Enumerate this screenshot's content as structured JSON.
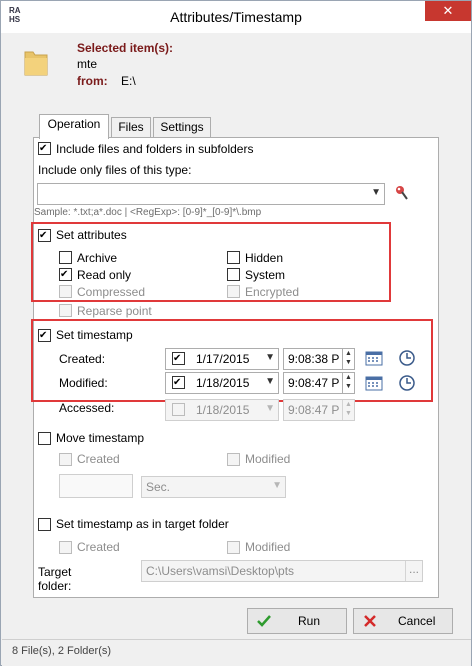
{
  "window": {
    "title": "Attributes/Timestamp",
    "app_icon_text": "RAHS"
  },
  "header": {
    "selected_label": "Selected item(s):",
    "selected_value": "mte",
    "from_label": "from:",
    "from_value": "E:\\"
  },
  "tabs": [
    "Operation",
    "Files",
    "Settings"
  ],
  "operation": {
    "include_subfolders": {
      "label": "Include files and folders in subfolders",
      "checked": true
    },
    "include_type_label": "Include only files of this type:",
    "include_type_value": "",
    "sample_hint": "Sample: *.txt;a*.doc | <RegExp>: [0-9]*_[0-9]*\\.bmp",
    "set_attributes": {
      "label": "Set attributes",
      "checked": true,
      "items": [
        {
          "label": "Archive",
          "checked": false,
          "enabled": true
        },
        {
          "label": "Hidden",
          "checked": false,
          "enabled": true
        },
        {
          "label": "Read only",
          "checked": true,
          "enabled": true
        },
        {
          "label": "System",
          "checked": false,
          "enabled": true
        },
        {
          "label": "Compressed",
          "checked": false,
          "enabled": false
        },
        {
          "label": "Encrypted",
          "checked": false,
          "enabled": false
        },
        {
          "label": "Reparse point",
          "checked": false,
          "enabled": false
        }
      ]
    },
    "set_timestamp": {
      "label": "Set timestamp",
      "checked": true,
      "created": {
        "label": "Created:",
        "checked": true,
        "date": "1/17/2015",
        "time": "9:08:38 P"
      },
      "modified": {
        "label": "Modified:",
        "checked": true,
        "date": "1/18/2015",
        "time": "9:08:47 P"
      },
      "accessed": {
        "label": "Accessed:",
        "checked": false,
        "date": "1/18/2015",
        "time": "9:08:47 P"
      }
    },
    "move_timestamp": {
      "label": "Move timestamp",
      "checked": false,
      "created_label": "Created",
      "modified_label": "Modified",
      "amount_value": "",
      "unit_value": "Sec."
    },
    "target_folder_timestamp": {
      "label": "Set timestamp as in target folder",
      "checked": false,
      "created_label": "Created",
      "modified_label": "Modified",
      "target_folder_label": "Target folder:",
      "target_folder_value": "C:\\Users\\vamsi\\Desktop\\pts",
      "browse_label": "..."
    }
  },
  "buttons": {
    "run": "Run",
    "cancel": "Cancel"
  },
  "status": "8 File(s), 2 Folder(s)",
  "colors": {
    "highlight_box": "#e0393a",
    "label_accent": "#7a1a1a",
    "close_button": "#c7372f"
  }
}
